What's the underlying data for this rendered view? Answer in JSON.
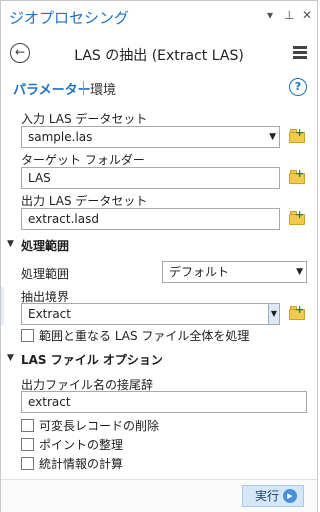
{
  "pane": {
    "title": "ジオプロセシング",
    "controls": {
      "dropdown": "▾",
      "pin": "⊥",
      "close": "✕"
    }
  },
  "tool": {
    "back_glyph": "←",
    "title": "LAS の抽出 (Extract LAS)"
  },
  "tabs": {
    "parameters": "パラメーター",
    "environments": "環境",
    "help_glyph": "?"
  },
  "params": {
    "input_label": "入力 LAS データセット",
    "input_value": "sample.las",
    "target_label": "ターゲット フォルダー",
    "target_value": "LAS",
    "output_label": "出力 LAS データセット",
    "output_value": "extract.lasd"
  },
  "processing_extent": {
    "header": "処理範囲",
    "extent_label": "処理範囲",
    "extent_value": "デフォルト",
    "boundary_label": "抽出境界",
    "boundary_value": "Extract",
    "overlap_checkbox": "範囲と重なる LAS ファイル全体を処理"
  },
  "las_options": {
    "header": "LAS ファイル オプション",
    "suffix_label": "出力ファイル名の接尾辞",
    "suffix_value": "extract",
    "checks": [
      "可変長レコードの削除",
      "ポイントの整理",
      "統計情報の計算"
    ]
  },
  "footer": {
    "run_label": "実行",
    "run_glyph": "▶"
  },
  "colors": {
    "accent": "#1a73c8",
    "folder": "#f2c94c",
    "run_button": "#d4e6f7"
  }
}
